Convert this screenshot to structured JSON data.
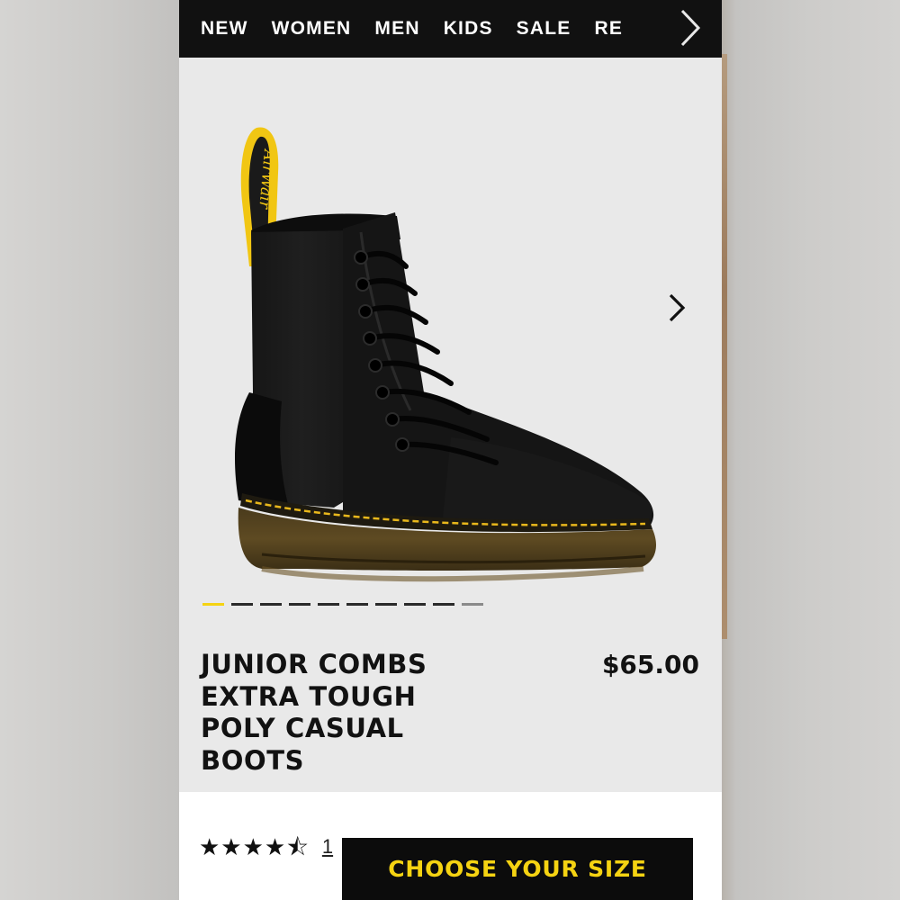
{
  "nav": {
    "items": [
      "NEW",
      "WOMEN",
      "MEN",
      "KIDS",
      "SALE",
      "RE"
    ]
  },
  "product": {
    "title": "JUNIOR COMBS EXTRA TOUGH POLY CASUAL BOOTS",
    "title_lines": [
      "JUNIOR COMBS",
      "EXTRA TOUGH",
      "POLY CASUAL",
      "BOOTS"
    ],
    "price": "$65.00",
    "pull_tab_text": "AirWair"
  },
  "gallery": {
    "image_count": 10,
    "active_index": 0
  },
  "rating": {
    "stars": "★★★★⯪",
    "reviews_text": "1"
  },
  "cta": {
    "label": "CHOOSE YOUR SIZE"
  },
  "colors": {
    "accent_yellow": "#f5d312",
    "nav_bg": "#111111",
    "hero_bg": "#e9e9e9"
  },
  "icons": {
    "nav_next": "chevron-right-icon",
    "image_next": "chevron-right-icon",
    "star": "star-icon"
  }
}
